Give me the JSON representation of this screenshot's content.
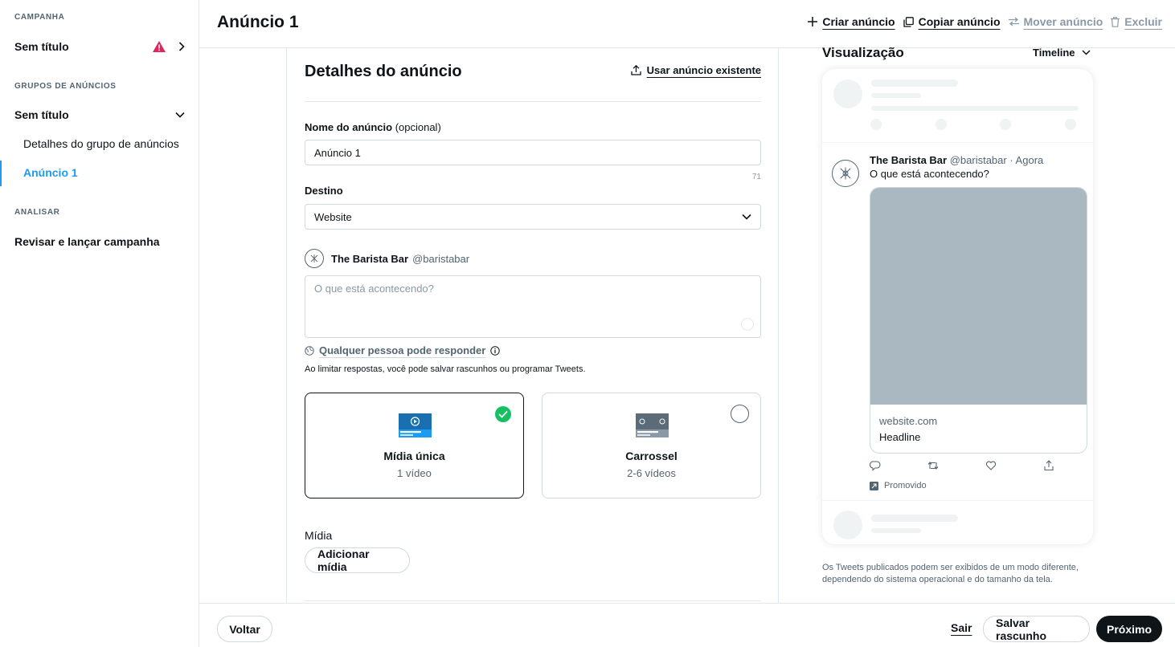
{
  "sidebar": {
    "campaign_heading": "CAMPANHA",
    "campaign_title": "Sem título",
    "adgroups_heading": "GRUPOS DE ANÚNCIOS",
    "adgroup_title": "Sem título",
    "adgroup_details": "Detalhes do grupo de anúncios",
    "ad_item": "Anúncio 1",
    "analyze_heading": "ANALISAR",
    "review_launch": "Revisar e lançar campanha"
  },
  "header": {
    "title": "Anúncio 1",
    "create_ad": "Criar anúncio",
    "copy_ad": "Copiar anúncio",
    "move_ad": "Mover anúncio",
    "delete": "Excluir"
  },
  "form": {
    "title": "Detalhes do anúncio",
    "use_existing": "Usar anúncio existente",
    "name_label": "Nome do anúncio",
    "name_optional": "(opcional)",
    "name_value": "Anúncio 1",
    "name_counter": "71",
    "destination_label": "Destino",
    "destination_value": "Website",
    "account_name": "The Barista Bar",
    "account_handle": "@baristabar",
    "tweet_placeholder": "O que está acontecendo?",
    "reply_setting": "Qualquer pessoa pode responder",
    "reply_note": "Ao limitar respostas, você pode salvar rascunhos ou programar Tweets.",
    "format_single_title": "Mídia única",
    "format_single_sub": "1 vídeo",
    "format_carousel_title": "Carrossel",
    "format_carousel_sub": "2-6 vídeos",
    "media_label": "Mídia",
    "add_media": "Adicionar mídia"
  },
  "preview": {
    "title": "Visualização",
    "placement": "Timeline",
    "tweet_name": "The Barista Bar",
    "tweet_meta": "@baristabar · Agora",
    "tweet_text": "O que está acontecendo?",
    "card_url": "website.com",
    "card_headline": "Headline",
    "promoted": "Promovido",
    "disclaimer": "Os Tweets publicados podem ser exibidos de um modo diferente, dependendo do sistema operacional e do tamanho da tela."
  },
  "footer": {
    "back": "Voltar",
    "exit": "Sair",
    "save_draft": "Salvar rascunho",
    "next": "Próximo"
  },
  "colors": {
    "accent": "#1d9bf0",
    "warning": "#e0245e",
    "success": "#17bf63",
    "primary_button": "#0f1419",
    "media_placeholder": "#aab8c2"
  },
  "icons": [
    "warning-icon",
    "chevron-right-icon",
    "chevron-down-icon",
    "plus-icon",
    "copy-icon",
    "move-icon",
    "trash-icon",
    "upload-icon",
    "globe-icon",
    "info-icon",
    "check-icon",
    "reply-icon",
    "retweet-icon",
    "like-icon",
    "share-icon",
    "promoted-icon"
  ]
}
